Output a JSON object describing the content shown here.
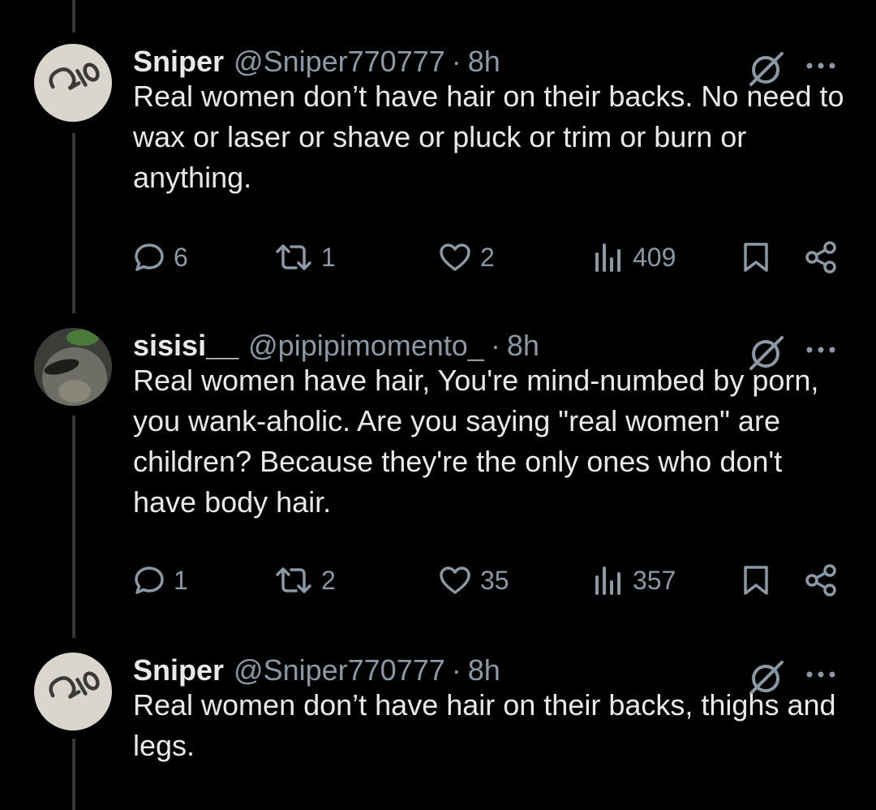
{
  "colors": {
    "background": "#000000",
    "text": "#e7e9ea",
    "muted": "#8b98a5",
    "thread_line": "#333639"
  },
  "tweets": [
    {
      "name": "Sniper",
      "handle": "@Sniper770777",
      "separator": "·",
      "time": "8h",
      "text": "Real women don’t have hair on their backs. No need to wax or laser or shave or pluck or trim or burn or anything.",
      "replies": "6",
      "reposts": "1",
      "likes": "2",
      "views": "409"
    },
    {
      "name": "sisisi__",
      "handle": "@pipipimomento_",
      "separator": "·",
      "time": "8h",
      "text": "Real women have hair, You're mind-numbed by porn, you wank-aholic. Are you saying \"real women\" are children? Because they're the only ones who don't have body hair.",
      "replies": "1",
      "reposts": "2",
      "likes": "35",
      "views": "357"
    },
    {
      "name": "Sniper",
      "handle": "@Sniper770777",
      "separator": "·",
      "time": "8h",
      "text": "Real women don’t have hair on their backs, thighs and legs."
    }
  ],
  "icons": [
    "reply-icon",
    "repost-icon",
    "like-icon",
    "views-icon",
    "bookmark-icon",
    "share-icon",
    "grok-icon",
    "more-icon"
  ]
}
